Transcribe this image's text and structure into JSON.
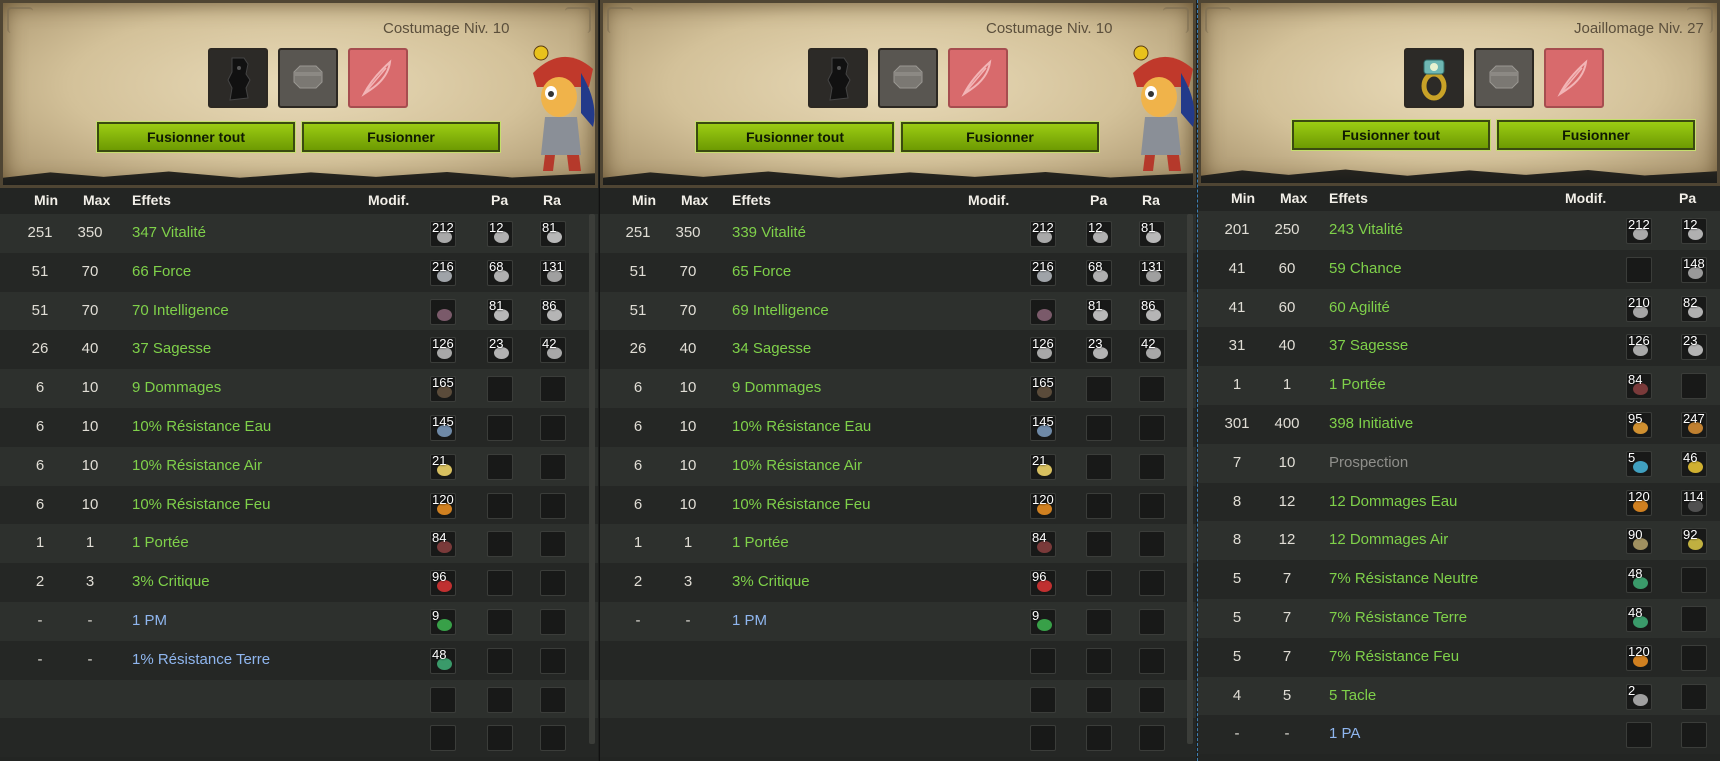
{
  "columns": {
    "min": "Min",
    "max": "Max",
    "effets": "Effets",
    "modif": "Modif.",
    "pa": "Pa",
    "ra": "Ra"
  },
  "buttons": {
    "fuse_all": "Fusionner tout",
    "fuse": "Fusionner"
  },
  "icons": [
    "mask-item-icon",
    "ring-item-icon",
    "empty-rune-slot-icon",
    "feather-icon"
  ],
  "colors": {
    "effect_green": "#7fd14a",
    "effect_blue": "#8fb6ef",
    "effect_grey": "#8f8f8b",
    "button_green": "#8bbd0a"
  },
  "panels": [
    {
      "profession": "Costumage Niv. 10",
      "rows": [
        {
          "min": "251",
          "max": "350",
          "effect": "347 Vitalité",
          "color": "g",
          "modif": "212",
          "pa": "12",
          "ra": "81"
        },
        {
          "min": "51",
          "max": "70",
          "effect": "66 Force",
          "color": "g",
          "modif": "216",
          "pa": "68",
          "ra": "131"
        },
        {
          "min": "51",
          "max": "70",
          "effect": "70 Intelligence",
          "color": "g",
          "modif": "",
          "pa": "81",
          "ra": "86"
        },
        {
          "min": "26",
          "max": "40",
          "effect": "37 Sagesse",
          "color": "g",
          "modif": "126",
          "pa": "23",
          "ra": "42"
        },
        {
          "min": "6",
          "max": "10",
          "effect": "9 Dommages",
          "color": "g",
          "modif": "165",
          "pa": "",
          "ra": ""
        },
        {
          "min": "6",
          "max": "10",
          "effect": "10% Résistance Eau",
          "color": "g",
          "modif": "145",
          "pa": "",
          "ra": ""
        },
        {
          "min": "6",
          "max": "10",
          "effect": "10% Résistance Air",
          "color": "g",
          "modif": "21",
          "pa": "",
          "ra": ""
        },
        {
          "min": "6",
          "max": "10",
          "effect": "10% Résistance Feu",
          "color": "g",
          "modif": "120",
          "pa": "",
          "ra": ""
        },
        {
          "min": "1",
          "max": "1",
          "effect": "1 Portée",
          "color": "g",
          "modif": "84",
          "pa": "",
          "ra": ""
        },
        {
          "min": "2",
          "max": "3",
          "effect": "3% Critique",
          "color": "g",
          "modif": "96",
          "pa": "",
          "ra": ""
        },
        {
          "min": "-",
          "max": "-",
          "effect": "1 PM",
          "color": "b",
          "modif": "9",
          "pa": "",
          "ra": ""
        },
        {
          "min": "-",
          "max": "-",
          "effect": "1% Résistance Terre",
          "color": "b",
          "modif": "48",
          "pa": "",
          "ra": ""
        },
        {
          "min": "",
          "max": "",
          "effect": "",
          "color": "g",
          "modif": "",
          "pa": "",
          "ra": ""
        },
        {
          "min": "",
          "max": "",
          "effect": "",
          "color": "g",
          "modif": "",
          "pa": "",
          "ra": ""
        }
      ]
    },
    {
      "profession": "Costumage Niv. 10",
      "rows": [
        {
          "min": "251",
          "max": "350",
          "effect": "339 Vitalité",
          "color": "g",
          "modif": "212",
          "pa": "12",
          "ra": "81"
        },
        {
          "min": "51",
          "max": "70",
          "effect": "65 Force",
          "color": "g",
          "modif": "216",
          "pa": "68",
          "ra": "131"
        },
        {
          "min": "51",
          "max": "70",
          "effect": "69 Intelligence",
          "color": "g",
          "modif": "",
          "pa": "81",
          "ra": "86"
        },
        {
          "min": "26",
          "max": "40",
          "effect": "34 Sagesse",
          "color": "g",
          "modif": "126",
          "pa": "23",
          "ra": "42"
        },
        {
          "min": "6",
          "max": "10",
          "effect": "9 Dommages",
          "color": "g",
          "modif": "165",
          "pa": "",
          "ra": ""
        },
        {
          "min": "6",
          "max": "10",
          "effect": "10% Résistance Eau",
          "color": "g",
          "modif": "145",
          "pa": "",
          "ra": ""
        },
        {
          "min": "6",
          "max": "10",
          "effect": "10% Résistance Air",
          "color": "g",
          "modif": "21",
          "pa": "",
          "ra": ""
        },
        {
          "min": "6",
          "max": "10",
          "effect": "10% Résistance Feu",
          "color": "g",
          "modif": "120",
          "pa": "",
          "ra": ""
        },
        {
          "min": "1",
          "max": "1",
          "effect": "1 Portée",
          "color": "g",
          "modif": "84",
          "pa": "",
          "ra": ""
        },
        {
          "min": "2",
          "max": "3",
          "effect": "3% Critique",
          "color": "g",
          "modif": "96",
          "pa": "",
          "ra": ""
        },
        {
          "min": "-",
          "max": "-",
          "effect": "1 PM",
          "color": "b",
          "modif": "9",
          "pa": "",
          "ra": ""
        },
        {
          "min": "",
          "max": "",
          "effect": "",
          "color": "g",
          "modif": "",
          "pa": "",
          "ra": ""
        },
        {
          "min": "",
          "max": "",
          "effect": "",
          "color": "g",
          "modif": "",
          "pa": "",
          "ra": ""
        },
        {
          "min": "",
          "max": "",
          "effect": "",
          "color": "g",
          "modif": "",
          "pa": "",
          "ra": ""
        }
      ]
    },
    {
      "profession": "Joaillomage Niv. 27",
      "rows": [
        {
          "min": "201",
          "max": "250",
          "effect": "243 Vitalité",
          "color": "g",
          "modif": "212",
          "pa": "12",
          "ra": ""
        },
        {
          "min": "41",
          "max": "60",
          "effect": "59 Chance",
          "color": "g",
          "modif": "",
          "pa": "148",
          "ra": ""
        },
        {
          "min": "41",
          "max": "60",
          "effect": "60 Agilité",
          "color": "g",
          "modif": "210",
          "pa": "82",
          "ra": ""
        },
        {
          "min": "31",
          "max": "40",
          "effect": "37 Sagesse",
          "color": "g",
          "modif": "126",
          "pa": "23",
          "ra": ""
        },
        {
          "min": "1",
          "max": "1",
          "effect": "1 Portée",
          "color": "g",
          "modif": "84",
          "pa": "",
          "ra": ""
        },
        {
          "min": "301",
          "max": "400",
          "effect": "398 Initiative",
          "color": "g",
          "modif": "95",
          "pa": "247",
          "ra": ""
        },
        {
          "min": "7",
          "max": "10",
          "effect": "Prospection",
          "color": "gr",
          "modif": "5",
          "pa": "46",
          "ra": ""
        },
        {
          "min": "8",
          "max": "12",
          "effect": "12 Dommages Eau",
          "color": "g",
          "modif": "120",
          "pa": "114",
          "ra": ""
        },
        {
          "min": "8",
          "max": "12",
          "effect": "12 Dommages Air",
          "color": "g",
          "modif": "90",
          "pa": "92",
          "ra": ""
        },
        {
          "min": "5",
          "max": "7",
          "effect": "7% Résistance Neutre",
          "color": "g",
          "modif": "48",
          "pa": "",
          "ra": ""
        },
        {
          "min": "5",
          "max": "7",
          "effect": "7% Résistance Terre",
          "color": "g",
          "modif": "48",
          "pa": "",
          "ra": ""
        },
        {
          "min": "5",
          "max": "7",
          "effect": "7% Résistance Feu",
          "color": "g",
          "modif": "120",
          "pa": "",
          "ra": ""
        },
        {
          "min": "4",
          "max": "5",
          "effect": "5 Tacle",
          "color": "g",
          "modif": "2",
          "pa": "",
          "ra": ""
        },
        {
          "min": "-",
          "max": "-",
          "effect": "1 PA",
          "color": "b",
          "modif": "",
          "pa": "",
          "ra": ""
        }
      ]
    }
  ]
}
